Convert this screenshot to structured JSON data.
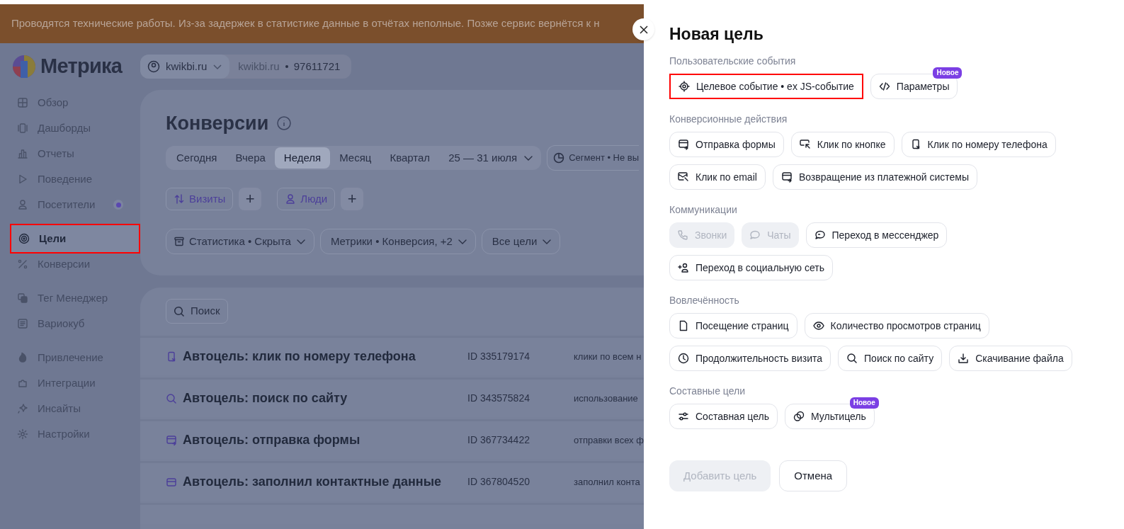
{
  "banner": {
    "text": "Проводятся технические работы. Из-за задержек в статистике данные в отчётах неполные. Позже сервис вернётся к н"
  },
  "logo": {
    "text": "Метрика"
  },
  "counter": {
    "site": "kwikbi.ru",
    "name": "kwikbi.ru",
    "id": "97611721"
  },
  "sidebar": {
    "groups": [
      [
        {
          "label": "Обзор",
          "selected": false,
          "highlighted": false,
          "dot": false
        },
        {
          "label": "Дашборды",
          "selected": false,
          "highlighted": false,
          "dot": false
        },
        {
          "label": "Отчеты",
          "selected": false,
          "highlighted": false,
          "dot": false
        },
        {
          "label": "Поведение",
          "selected": false,
          "highlighted": false,
          "dot": false
        },
        {
          "label": "Посетители",
          "selected": false,
          "highlighted": false,
          "dot": true
        }
      ],
      [
        {
          "label": "Цели",
          "selected": true,
          "highlighted": true,
          "dot": false
        },
        {
          "label": "Конверсии",
          "selected": false,
          "highlighted": false,
          "dot": false
        }
      ],
      [
        {
          "label": "Тег Менеджер",
          "selected": false,
          "highlighted": false,
          "dot": false
        },
        {
          "label": "Вариокуб",
          "selected": false,
          "highlighted": false,
          "dot": false
        }
      ],
      [
        {
          "label": "Привлечение",
          "selected": false,
          "highlighted": false,
          "dot": false
        },
        {
          "label": "Интеграции",
          "selected": false,
          "highlighted": false,
          "dot": false
        },
        {
          "label": "Инсайты",
          "selected": false,
          "highlighted": false,
          "dot": false
        },
        {
          "label": "Настройки",
          "selected": false,
          "highlighted": false,
          "dot": false
        }
      ]
    ]
  },
  "report": {
    "title": "Конверсии",
    "periods": [
      {
        "label": "Сегодня",
        "selected": false
      },
      {
        "label": "Вчера",
        "selected": false
      },
      {
        "label": "Неделя",
        "selected": true
      },
      {
        "label": "Месяц",
        "selected": false
      },
      {
        "label": "Квартал",
        "selected": false
      }
    ],
    "date_range": "25 — 31 июля",
    "segment": "Сегмент • Не вы",
    "groupings": [
      {
        "label": "Визиты",
        "add": "+"
      },
      {
        "label": "Люди",
        "add": "+"
      }
    ],
    "filters": [
      "Статистика • Скрыта",
      "Метрики • Конверсия, +2",
      "Все цели"
    ]
  },
  "goals": {
    "search": "Поиск",
    "rows": [
      {
        "title": "Автоцель: клик по номеру телефона",
        "id": "ID 335179174",
        "description": "клики по всем н"
      },
      {
        "title": "Автоцель: поиск по сайту",
        "id": "ID 343575824",
        "description": "использование"
      },
      {
        "title": "Автоцель: отправка формы",
        "id": "ID 367734422",
        "description": "отправки всех ф"
      },
      {
        "title": "Автоцель: заполнил контактные данные",
        "id": "ID 367804520",
        "description": "заполнил конта"
      }
    ]
  },
  "panel": {
    "title": "Новая цель",
    "sections": [
      {
        "title": "Пользовательские события",
        "options": [
          {
            "label": "Целевое событие • ex JS-событие",
            "disabled": false,
            "highlighted": true
          },
          {
            "label": "Параметры",
            "disabled": false,
            "highlighted": false,
            "badge": "Новое"
          }
        ]
      },
      {
        "title": "Конверсионные действия",
        "options": [
          {
            "label": "Отправка формы",
            "disabled": false,
            "highlighted": false
          },
          {
            "label": "Клик по кнопке",
            "disabled": false,
            "highlighted": false
          },
          {
            "label": "Клик по номеру телефона",
            "disabled": false,
            "highlighted": false
          },
          {
            "label": "Клик по email",
            "disabled": false,
            "highlighted": false
          },
          {
            "label": "Возвращение из платежной системы",
            "disabled": false,
            "highlighted": false
          }
        ]
      },
      {
        "title": "Коммуникации",
        "options": [
          {
            "label": "Звонки",
            "disabled": true,
            "highlighted": false
          },
          {
            "label": "Чаты",
            "disabled": true,
            "highlighted": false
          },
          {
            "label": "Переход в мессенджер",
            "disabled": false,
            "highlighted": false
          },
          {
            "label": "Переход в социальную сеть",
            "disabled": false,
            "highlighted": false
          }
        ]
      },
      {
        "title": "Вовлечённость",
        "options": [
          {
            "label": "Посещение страниц",
            "disabled": false,
            "highlighted": false
          },
          {
            "label": "Количество просмотров страниц",
            "disabled": false,
            "highlighted": false
          },
          {
            "label": "Продолжительность визита",
            "disabled": false,
            "highlighted": false
          },
          {
            "label": "Поиск по сайту",
            "disabled": false,
            "highlighted": false
          },
          {
            "label": "Скачивание файла",
            "disabled": false,
            "highlighted": false
          }
        ]
      },
      {
        "title": "Составные цели",
        "options": [
          {
            "label": "Составная цель",
            "disabled": false,
            "highlighted": false
          },
          {
            "label": "Мультицель",
            "disabled": false,
            "highlighted": false,
            "badge": "Новое"
          }
        ]
      }
    ],
    "buttons": [
      {
        "label": "Добавить цель",
        "disabled": true
      },
      {
        "label": "Отмена",
        "disabled": false
      }
    ]
  }
}
